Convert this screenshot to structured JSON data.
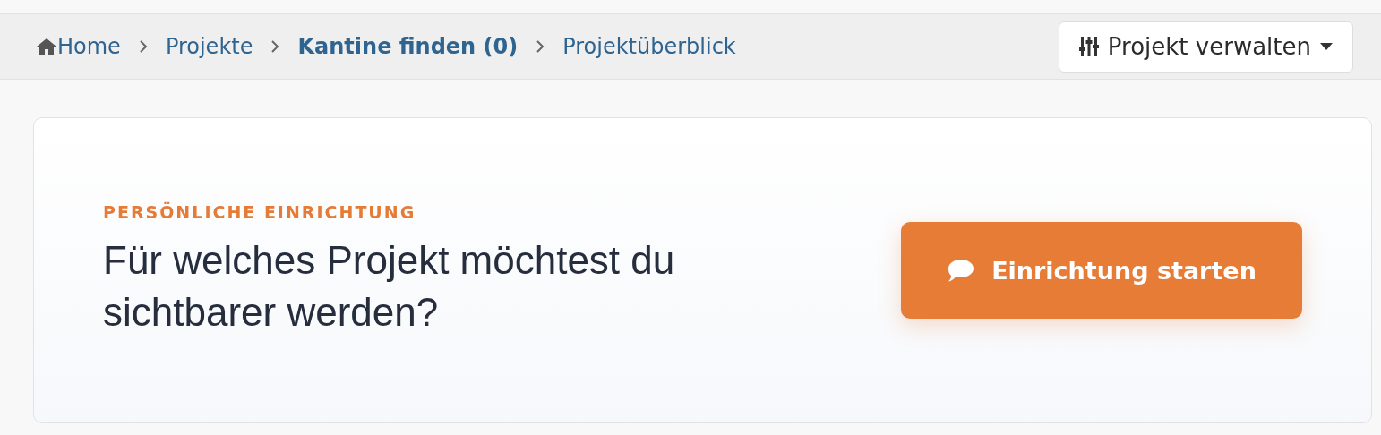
{
  "breadcrumb": [
    {
      "label": "Home",
      "kind": "home",
      "emphasized": false
    },
    {
      "label": "Projekte",
      "kind": "link",
      "emphasized": false
    },
    {
      "label": "Kantine finden (0)",
      "kind": "link",
      "emphasized": true
    },
    {
      "label": "Projektüberblick",
      "kind": "link",
      "emphasized": false
    }
  ],
  "manage_button": {
    "label": "Projekt verwalten"
  },
  "card": {
    "eyebrow": "PERSÖNLICHE EINRICHTUNG",
    "heading": "Für welches Projekt möchtest du sichtbarer werden?",
    "action": {
      "label": "Einrichtung starten"
    }
  }
}
